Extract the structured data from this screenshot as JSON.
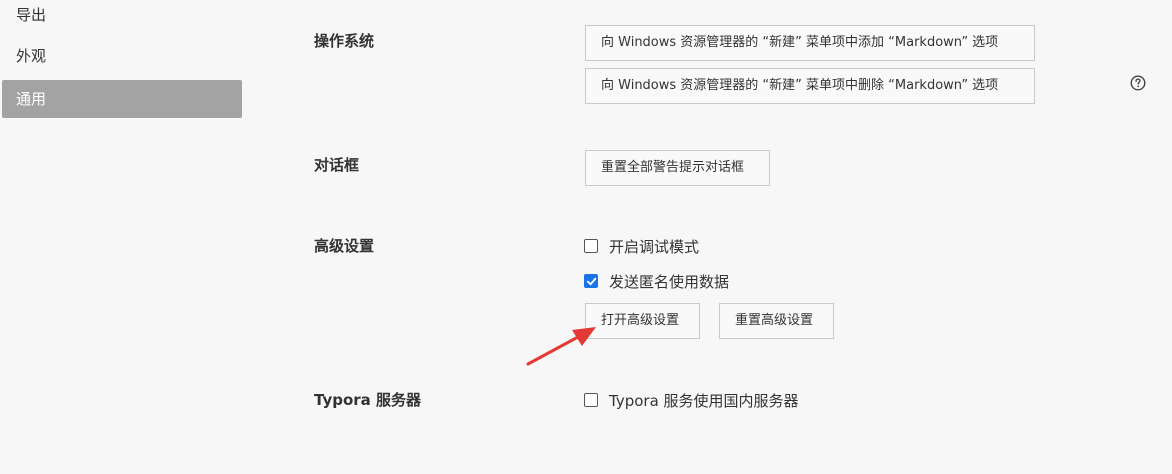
{
  "sidebar": {
    "items": [
      {
        "label": "导出"
      },
      {
        "label": "外观"
      },
      {
        "label": "通用"
      }
    ]
  },
  "sections": {
    "os": {
      "label": "操作系统",
      "add_button": "向 Windows 资源管理器的 “新建” 菜单项中添加 “Markdown” 选项",
      "remove_button": "向 Windows 资源管理器的 “新建” 菜单项中删除 “Markdown” 选项"
    },
    "dialogs": {
      "label": "对话框",
      "reset_button": "重置全部警告提示对话框"
    },
    "advanced": {
      "label": "高级设置",
      "debug_label": "开启调试模式",
      "debug_checked": false,
      "anon_label": "发送匿名使用数据",
      "anon_checked": true,
      "open_button": "打开高级设置",
      "reset_button": "重置高级设置"
    },
    "server": {
      "label": "Typora 服务器",
      "domestic_label": "Typora 服务使用国内服务器",
      "domestic_checked": false
    }
  },
  "colors": {
    "sidebar_active_bg": "#a3a3a3",
    "checkbox_checked": "#1a73e8",
    "annotation_arrow": "#e53935"
  },
  "icons": {
    "help": "question-circle-icon",
    "check": "checkmark-icon",
    "annotation": "red-arrow-annotation"
  }
}
